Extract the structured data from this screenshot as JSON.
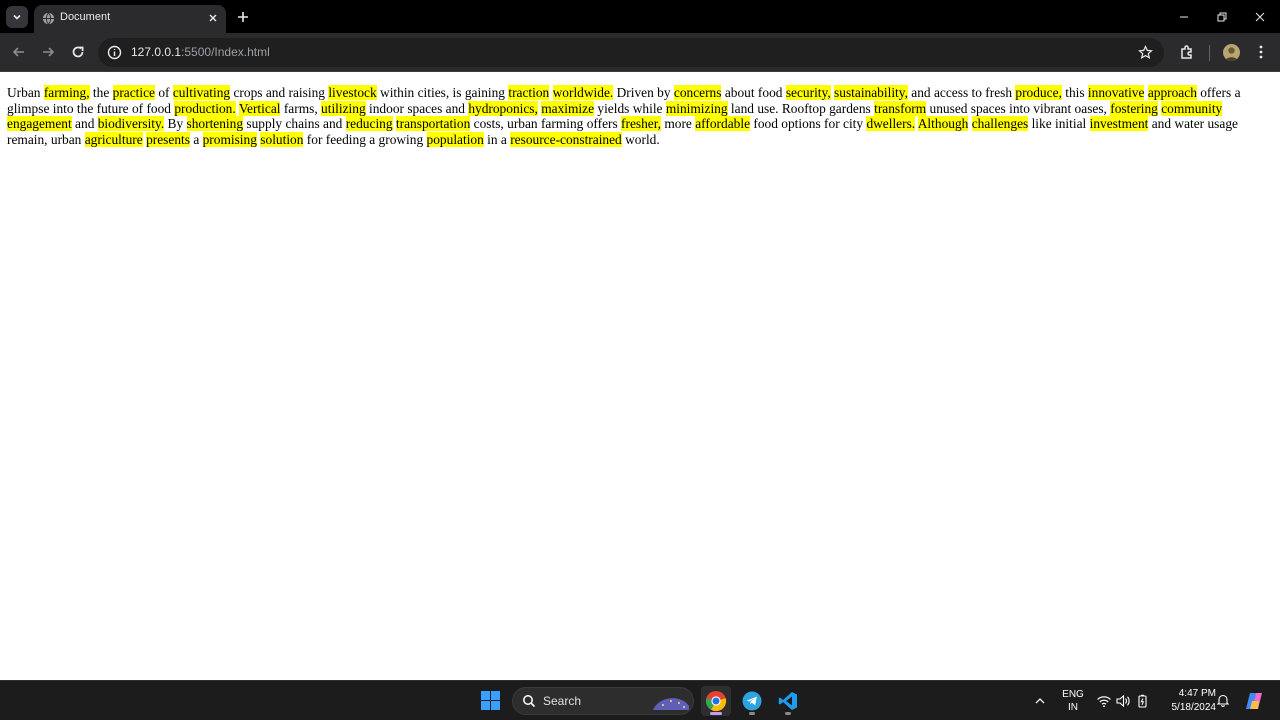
{
  "browser": {
    "tab": {
      "title": "Document"
    },
    "address": {
      "host": "127.0.0.1",
      "rest": ":5500/Index.html"
    }
  },
  "page": {
    "segments": [
      {
        "t": "Urban ",
        "h": false
      },
      {
        "t": "farming,",
        "h": true
      },
      {
        "t": " the ",
        "h": false
      },
      {
        "t": "practice",
        "h": true
      },
      {
        "t": " of ",
        "h": false
      },
      {
        "t": "cultivating",
        "h": true
      },
      {
        "t": " crops and raising ",
        "h": false
      },
      {
        "t": "livestock",
        "h": true
      },
      {
        "t": " within cities, is gaining ",
        "h": false
      },
      {
        "t": "traction",
        "h": true
      },
      {
        "t": " ",
        "h": false
      },
      {
        "t": "worldwide.",
        "h": true
      },
      {
        "t": " Driven by ",
        "h": false
      },
      {
        "t": "concerns",
        "h": true
      },
      {
        "t": " about food ",
        "h": false
      },
      {
        "t": "security,",
        "h": true
      },
      {
        "t": " ",
        "h": false
      },
      {
        "t": "sustainability,",
        "h": true
      },
      {
        "t": " and access to fresh ",
        "h": false
      },
      {
        "t": "produce,",
        "h": true
      },
      {
        "t": " this ",
        "h": false
      },
      {
        "t": "innovative",
        "h": true
      },
      {
        "t": " ",
        "h": false
      },
      {
        "t": "approach",
        "h": true
      },
      {
        "t": " offers a glimpse into the future of food ",
        "h": false
      },
      {
        "t": "production.",
        "h": true
      },
      {
        "t": " ",
        "h": false
      },
      {
        "t": "Vertical",
        "h": true
      },
      {
        "t": " farms, ",
        "h": false
      },
      {
        "t": "utilizing",
        "h": true
      },
      {
        "t": " indoor spaces and ",
        "h": false
      },
      {
        "t": "hydroponics,",
        "h": true
      },
      {
        "t": " ",
        "h": false
      },
      {
        "t": "maximize",
        "h": true
      },
      {
        "t": " yields while ",
        "h": false
      },
      {
        "t": "minimizing",
        "h": true
      },
      {
        "t": " land use. Rooftop gardens ",
        "h": false
      },
      {
        "t": "transform",
        "h": true
      },
      {
        "t": " unused spaces into vibrant oases, ",
        "h": false
      },
      {
        "t": "fostering",
        "h": true
      },
      {
        "t": " ",
        "h": false
      },
      {
        "t": "community",
        "h": true
      },
      {
        "t": " ",
        "h": false
      },
      {
        "t": "engagement",
        "h": true
      },
      {
        "t": " and ",
        "h": false
      },
      {
        "t": "biodiversity.",
        "h": true
      },
      {
        "t": " By ",
        "h": false
      },
      {
        "t": "shortening",
        "h": true
      },
      {
        "t": " supply chains and ",
        "h": false
      },
      {
        "t": "reducing",
        "h": true
      },
      {
        "t": " ",
        "h": false
      },
      {
        "t": "transportation",
        "h": true
      },
      {
        "t": " costs, urban farming offers ",
        "h": false
      },
      {
        "t": "fresher,",
        "h": true
      },
      {
        "t": " more ",
        "h": false
      },
      {
        "t": "affordable",
        "h": true
      },
      {
        "t": " food options for city ",
        "h": false
      },
      {
        "t": "dwellers.",
        "h": true
      },
      {
        "t": " ",
        "h": false
      },
      {
        "t": "Although",
        "h": true
      },
      {
        "t": " ",
        "h": false
      },
      {
        "t": "challenges",
        "h": true
      },
      {
        "t": " like initial ",
        "h": false
      },
      {
        "t": "investment",
        "h": true
      },
      {
        "t": " and water usage remain, urban ",
        "h": false
      },
      {
        "t": "agriculture",
        "h": true
      },
      {
        "t": " ",
        "h": false
      },
      {
        "t": "presents",
        "h": true
      },
      {
        "t": " a ",
        "h": false
      },
      {
        "t": "promising",
        "h": true
      },
      {
        "t": " ",
        "h": false
      },
      {
        "t": "solution",
        "h": true
      },
      {
        "t": " for feeding a growing ",
        "h": false
      },
      {
        "t": "population",
        "h": true
      },
      {
        "t": " in a ",
        "h": false
      },
      {
        "t": "resource-constrained",
        "h": true
      },
      {
        "t": " world.",
        "h": false
      }
    ],
    "highlight_color": "#ffff00"
  },
  "taskbar": {
    "search_label": "Search",
    "apps": [
      "chrome-icon",
      "telegram-icon",
      "vscode-icon"
    ],
    "language": {
      "line1": "ENG",
      "line2": "IN"
    },
    "clock": {
      "time": "4:47 PM",
      "date": "5/18/2024"
    }
  },
  "colors": {
    "accent_windows": "#0a84ff",
    "telegram": "#2aa3df",
    "vscode": "#1f9cf0"
  }
}
